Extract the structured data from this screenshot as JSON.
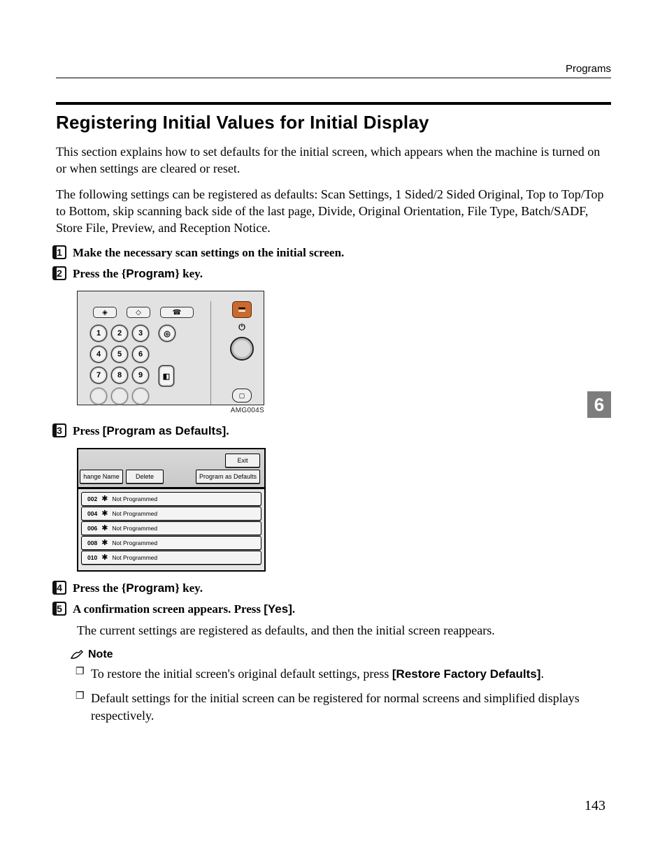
{
  "header": {
    "section": "Programs"
  },
  "title": "Registering Initial Values for Initial Display",
  "intro1": "This section explains how to set defaults for the initial screen, which appears when the machine is turned on or when settings are cleared or reset.",
  "intro2": "The following settings can be registered as defaults: Scan Settings, 1 Sided/2 Sided Original, Top to Top/Top to Bottom, skip scanning back side of the last page, Divide, Original Orientation, File Type, Batch/SADF, Store File, Preview, and Reception Notice.",
  "steps": {
    "s1": "Make the necessary scan settings on the initial screen.",
    "s2_a": "Press the ",
    "s2_key": "Program",
    "s2_b": " key.",
    "s3_a": "Press ",
    "s3_bold": "[Program as Defaults]",
    "s3_b": ".",
    "s4_a": "Press the ",
    "s4_key": "Program",
    "s4_b": " key.",
    "s5_a": "A confirmation screen appears. Press ",
    "s5_bold": "[Yes]",
    "s5_b": "."
  },
  "fig1": {
    "keys_r1": [
      "1",
      "2",
      "3"
    ],
    "keys_r2": [
      "4",
      "5",
      "6"
    ],
    "keys_r3": [
      "7",
      "8",
      "9"
    ],
    "code": "AMG004S"
  },
  "fig2": {
    "exit": "Exit",
    "change_name": "hange Name",
    "delete": "Delete",
    "pad": "Program as Defaults",
    "rows": [
      {
        "num": "002",
        "status": "Not Programmed"
      },
      {
        "num": "004",
        "status": "Not Programmed"
      },
      {
        "num": "006",
        "status": "Not Programmed"
      },
      {
        "num": "008",
        "status": "Not Programmed"
      },
      {
        "num": "010",
        "status": "Not Programmed"
      }
    ]
  },
  "after5": "The current settings are registered as defaults, and then the initial screen reappears.",
  "note_label": "Note",
  "notes": {
    "n1_a": "To restore the initial screen's original default settings, press ",
    "n1_bold": "[Restore Factory Defaults]",
    "n1_b": ".",
    "n2": "Default settings for the initial screen can be registered for normal screens and simplified displays respectively."
  },
  "tab": "6",
  "page_number": "143"
}
